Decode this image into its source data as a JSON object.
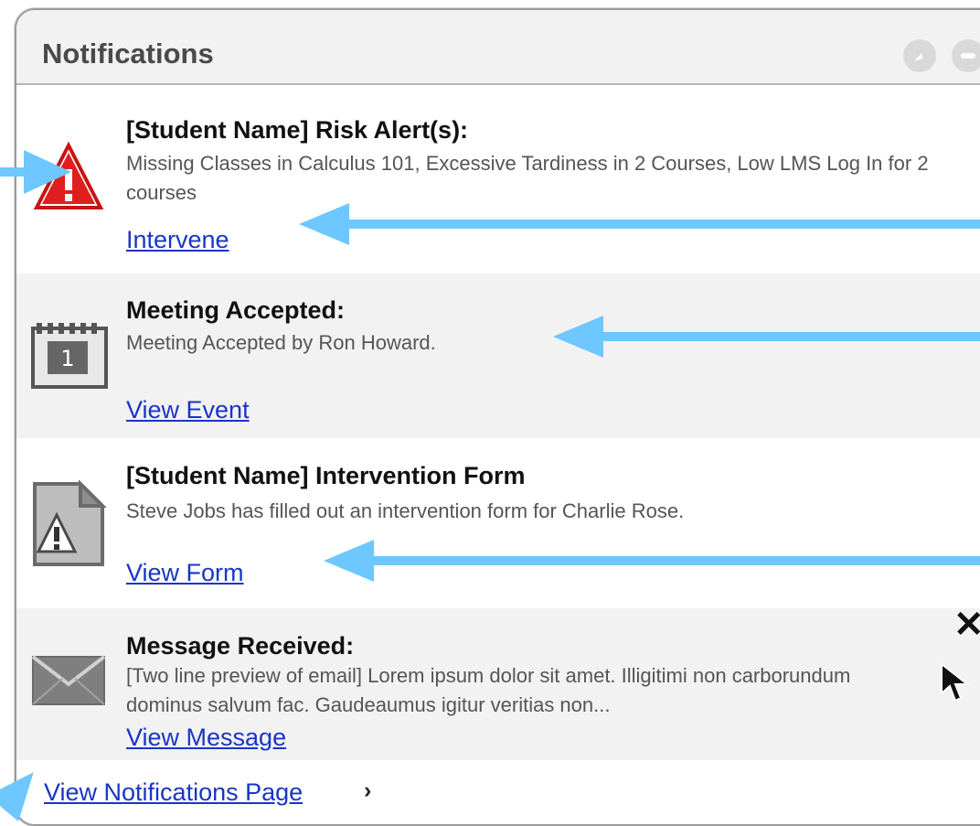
{
  "header": {
    "title": "Notifications",
    "icons": [
      "compass-icon",
      "minus-circle-icon"
    ]
  },
  "notifications": [
    {
      "title": "[Student Name] Risk Alert(s):",
      "description": "Missing Classes in Calculus 101,  Excessive Tardiness in 2 Courses, Low LMS Log In for 2 courses",
      "link": "Intervene",
      "icon": "warning-icon"
    },
    {
      "title": "Meeting Accepted:",
      "description": "Meeting Accepted by Ron Howard.",
      "link": "View Event",
      "icon": "calendar-icon"
    },
    {
      "title": "[Student Name] Intervention Form",
      "description": "Steve Jobs has filled out an intervention form for Charlie Rose.",
      "link": "View Form",
      "icon": "document-warning-icon"
    },
    {
      "title": "Message Received:",
      "description": "[Two line preview of email] Lorem ipsum dolor sit amet. Illigitimi non carborundum dominus salvum fac. Gaudeaumus igitur veritias non...",
      "link": "View Message",
      "icon": "envelope-icon"
    }
  ],
  "footer": {
    "link": "View Notifications Page",
    "chevron": "›"
  },
  "overlay": {
    "dismiss": "✕"
  },
  "colors": {
    "link": "#1a35c8",
    "accent_arrow": "#6ec7ff",
    "item_gray": "#f2f2f2"
  }
}
